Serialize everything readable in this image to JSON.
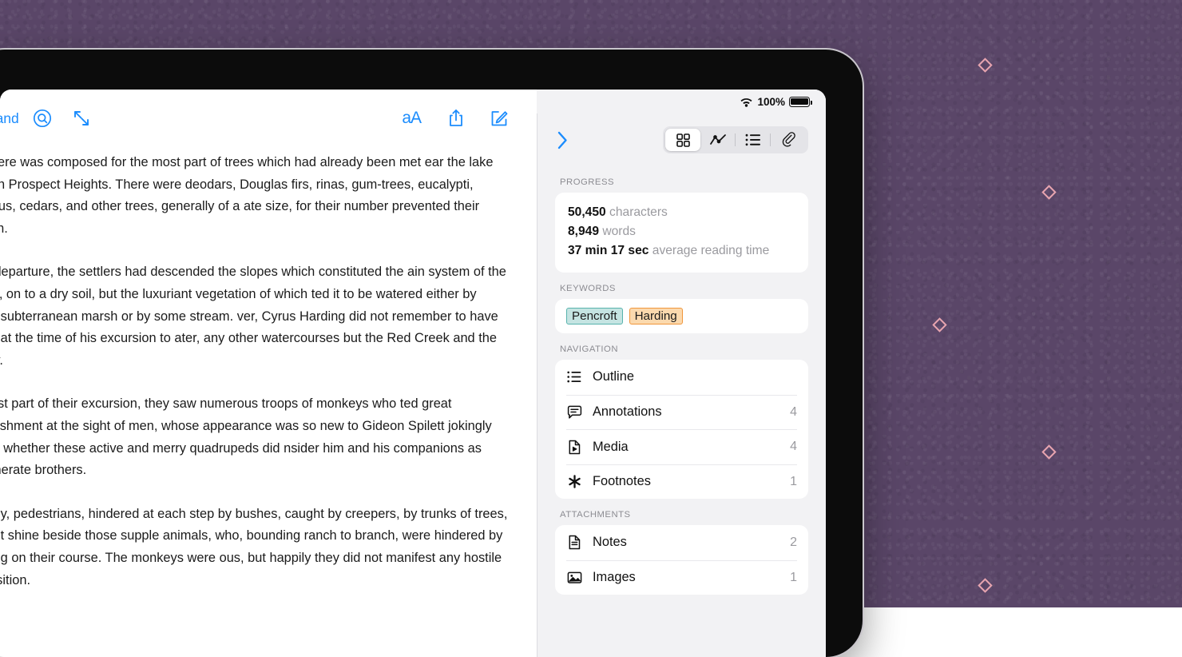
{
  "statusbar": {
    "wifi_icon": "wifi-icon",
    "battery_percent": "100%",
    "battery_icon": "battery-full-icon"
  },
  "reader": {
    "title": "ous Island",
    "toolbar": [
      {
        "name": "search-icon",
        "label": "Search"
      },
      {
        "name": "expand-icon",
        "label": "Expand"
      },
      {
        "name": "text-size-icon",
        "label": "aA"
      },
      {
        "name": "share-icon",
        "label": "Share"
      },
      {
        "name": "compose-icon",
        "label": "Compose"
      }
    ],
    "paragraphs": [
      "rest here was composed for the most part of trees which had already been met ear the lake and on Prospect Heights. There were deodars, Douglas firs, rinas, gum-trees, eucalypti, hibiscus, cedars, and other trees, generally of a ate size, for their number prevented their growth.",
      "their departure, the settlers had descended the slopes which constituted the ain system of the island, on to a dry soil, but the luxuriant vegetation of which ted it to be watered either by some subterranean marsh or by some stream. ver, Cyrus Harding did not remember to have seen, at the time of his excursion to ater, any other watercourses but the Red Creek and the Mercy.",
      "the first part of their excursion, they saw numerous troops of monkeys who ted great astonishment at the sight of men, whose appearance was so new to Gideon Spilett jokingly asked whether these active and merry quadrupeds did nsider him and his companions as degenerate brothers.",
      "ertainly, pedestrians, hindered at each step by bushes, caught by creepers, by trunks of trees, did not shine beside those supple animals, who, bounding ranch to branch, were hindered by nothing on their course. The monkeys were ous, but happily they did not manifest any hostile disposition."
    ]
  },
  "sidebar": {
    "collapse_icon": "chevron-right-icon",
    "segments": [
      {
        "name": "grid-icon",
        "label": "Overview",
        "active": true
      },
      {
        "name": "chart-line-icon",
        "label": "Statistics",
        "active": false
      },
      {
        "name": "list-icon",
        "label": "Outline",
        "active": false
      },
      {
        "name": "paperclip-icon",
        "label": "Attachments",
        "active": false
      }
    ],
    "progress": {
      "label": "PROGRESS",
      "characters_value": "50,450",
      "characters_unit": "characters",
      "words_value": "8,949",
      "words_unit": "words",
      "reading_value": "37 min 17 sec",
      "reading_unit": "average reading time"
    },
    "keywords": {
      "label": "KEYWORDS",
      "tags": [
        {
          "text": "Pencroft",
          "style": "teal",
          "bg": "#c5e4e2",
          "border": "#57b3ad"
        },
        {
          "text": "Harding",
          "style": "orange",
          "bg": "#fbd9ae",
          "border": "#f0963b"
        }
      ]
    },
    "navigation": {
      "label": "NAVIGATION",
      "items": [
        {
          "icon": "list-icon",
          "label": "Outline",
          "count": ""
        },
        {
          "icon": "comment-icon",
          "label": "Annotations",
          "count": "4"
        },
        {
          "icon": "media-file-icon",
          "label": "Media",
          "count": "4"
        },
        {
          "icon": "asterisk-icon",
          "label": "Footnotes",
          "count": "1"
        }
      ]
    },
    "attachments": {
      "label": "ATTACHMENTS",
      "items": [
        {
          "icon": "document-icon",
          "label": "Notes",
          "count": "2"
        },
        {
          "icon": "image-icon",
          "label": "Images",
          "count": "1"
        }
      ]
    }
  },
  "theme": {
    "accent": "#1b8cfd",
    "backdrop": "#5a4668",
    "diamond": "#e8a5b0",
    "sidebar_bg": "#f2f2f4"
  }
}
